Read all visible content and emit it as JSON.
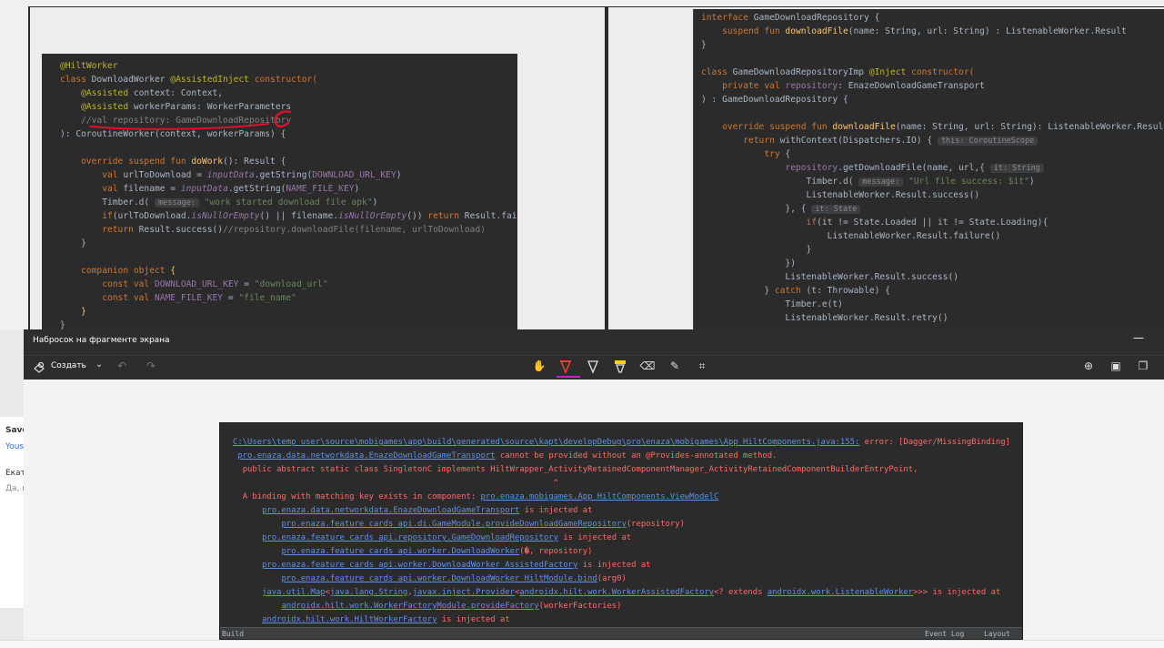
{
  "snip": {
    "title": "Набросок на фрагменте экрана",
    "minimize": "—",
    "create_label": "Создать"
  },
  "side_panel": {
    "item1": "Save",
    "item2": "Yous",
    "item3": "Екат",
    "item4": "Да, к"
  },
  "code_left": {
    "l1_annotation": "@HiltWorker",
    "l2_kw": "class ",
    "l2_name": "DownloadWorker ",
    "l2_annotation": "@AssistedInject ",
    "l2_kw2": "constructor(",
    "l3_annotation": "@Assisted ",
    "l3_rest": "context: Context,",
    "l4_annotation": "@Assisted ",
    "l4_rest": "workerParams: WorkerParameters",
    "l5_comment": "//val repository: GameDownloadRepository",
    "l6": "): CoroutineWorker(context, workerParams) {",
    "l7_kw": "override suspend fun ",
    "l7_fn": "doWork",
    "l7_rest": "(): Result {",
    "l8_kw": "val ",
    "l8_a": "urlToDownload = ",
    "l8_it": "inputData",
    "l8_b": ".getString(",
    "l8_prop": "DOWNLOAD_URL_KEY",
    "l8_c": ")",
    "l9_kw": "val ",
    "l9_a": "filename = ",
    "l9_it": "inputData",
    "l9_b": ".getString(",
    "l9_prop": "NAME_FILE_KEY",
    "l9_c": ")",
    "l10_a": "Timber.d( ",
    "l10_hint": "message:",
    "l10_str": " \"work started download file apk\"",
    "l10_c": ")",
    "l11_kw": "if",
    "l11_a": "(urlToDownload.",
    "l11_it": "isNullOrEmpty",
    "l11_b": "() || filename.",
    "l11_it2": "isNullOrEmpty",
    "l11_c": "()) ",
    "l11_kw2": "return ",
    "l11_d": "Result.failure()",
    "l12_kw": "return ",
    "l12_a": "Result.success()",
    "l12_cm": "//repository.downloadFile(filename, urlToDownload)",
    "l13": "}",
    "l14_kw": "companion object ",
    "l14_b": "{",
    "l15_kw": "const val ",
    "l15_prop": "DOWNLOAD_URL_KEY",
    "l15_a": " = ",
    "l15_str": "\"download_url\"",
    "l16_kw": "const val ",
    "l16_prop": "NAME_FILE_KEY",
    "l16_a": " = ",
    "l16_str": "\"file_name\"",
    "l17": "}",
    "l18": "}"
  },
  "code_right": {
    "r1_kw": "interface ",
    "r1_a": "GameDownloadRepository {",
    "r2_kw": "suspend fun ",
    "r2_fn": "downloadFile",
    "r2_a": "(name: String, url: String) : ListenableWorker.Result",
    "r3": "}",
    "r4_kw": "class ",
    "r4_a": "GameDownloadRepositoryImp ",
    "r4_an": "@Inject ",
    "r4_kw2": "constructor(",
    "r5_kw": "private val ",
    "r5_prop": "repository",
    "r5_a": ": EnazeDownloadGameTransport",
    "r6": ") : GameDownloadRepository {",
    "r7_kw": "override suspend fun ",
    "r7_fn": "downloadFile",
    "r7_a": "(name: String, url: String): ListenableWorker.Result {",
    "r8_kw": "return ",
    "r8_a": "withContext(Dispatchers.IO) { ",
    "r8_hint": "this: CoroutineScope",
    "r9_kw": "try ",
    "r9_a": "{",
    "r10_prop": "repository",
    "r10_a": ".getDownloadFile(name, url,{ ",
    "r10_hint": "it: String",
    "r11_a": "Timber.d( ",
    "r11_hint": "message:",
    "r11_str": " \"Url file success: $it\"",
    "r11_c": ")",
    "r12": "ListenableWorker.Result.success()",
    "r13_a": "}, { ",
    "r13_hint": "it: State",
    "r14_kw": "if",
    "r14_a": "(it != State.Loaded || it != State.Loading){",
    "r15": "ListenableWorker.Result.failure()",
    "r16": "}",
    "r17": "})",
    "r18": "ListenableWorker.Result.success()",
    "r19_a": "} ",
    "r19_kw": "catch ",
    "r19_b": "(t: Throwable) {",
    "r20": "Timber.e(t)",
    "r21": "ListenableWorker.Result.retry()"
  },
  "error": {
    "e1_link": "C:\\Users\\temp_user\\source\\mobigames\\app\\build\\generated\\source\\kapt\\developDebug\\pro\\enaza\\mobigames\\App_HiltComponents.java:155:",
    "e1_text": " error: [Dagger/MissingBinding]",
    "e2_link": "pro.enaza.data.networkdata.EnazeDownloadGameTransport",
    "e2_text": " cannot be provided without an @Provides-annotated method.",
    "e3": "public abstract static class SingletonC implements HiltWrapper_ActivityRetainedComponentManager_ActivityRetainedComponentBuilderEntryPoint,",
    "e4": "^",
    "e5_text": "A binding with matching key exists in component: ",
    "e5_link": "pro.enaza.mobigames.App_HiltComponents.ViewModelC",
    "e6_link": "pro.enaza.data.networkdata.EnazeDownloadGameTransport",
    "e6_text": " is injected at",
    "e7_link": "pro.enaza.feature_cards_api.di.GameModule.provideDownloadGameRepository",
    "e7_text": "(repository)",
    "e8_link": "pro.enaza.feature_cards_api.repository.GameDownloadRepository",
    "e8_text": " is injected at",
    "e9_link": "pro.enaza.feature_cards_api.worker.DownloadWorker",
    "e9_text": "(�, repository)",
    "e10_link": "pro.enaza.feature_cards_api.worker.DownloadWorker_AssistedFactory",
    "e10_text": " is injected at",
    "e11_link": "pro.enaza.feature_cards_api.worker.DownloadWorker_HiltModule.bind",
    "e11_text": "(arg0)",
    "e12_link": "java.util.Map",
    "e12_a": "<",
    "e12_link2": "java.lang.String",
    "e12_b": ",",
    "e12_link3": "javax.inject.Provider",
    "e12_c": "<",
    "e12_link4": "androidx.hilt.work.WorkerAssistedFactory",
    "e12_d": "<? extends ",
    "e12_link5": "androidx.work.ListenableWorker",
    "e12_e": ">>> is injected at",
    "e13_link": "androidx.hilt.work.WorkerFactoryModule.provideFactory",
    "e13_text": "(workerFactories)",
    "e14_link": "androidx.hilt.work.HiltWorkerFactory",
    "e14_text": " is injected at",
    "status_build": "Build",
    "status_event": "Event Log",
    "status_layout": "Layout"
  }
}
